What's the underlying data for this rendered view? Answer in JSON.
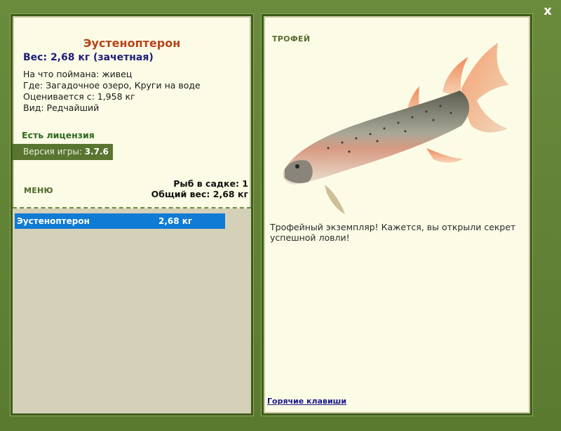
{
  "window": {
    "close_label": "x"
  },
  "fish": {
    "name": "Эустеноптерон",
    "weight": "Вес: 2,68 кг (зачетная)",
    "caught_on": "На что поймана: живец",
    "location": "Где: Загадочное озеро, Круги на воде",
    "value": "Оценивается с: 1,958 кг",
    "rarity": "Вид: Редчайший"
  },
  "license": "Есть лицензия",
  "version": {
    "label": "Версия игры:",
    "value": "3.7.6"
  },
  "menu_label": "МЕНЮ",
  "keepnet": {
    "count": "Рыб в садке: 1",
    "total": "Общий вес: 2,68 кг"
  },
  "catch_list": [
    {
      "name": "Эустеноптерон",
      "weight": "2,68 кг"
    }
  ],
  "trophy": {
    "title": "ТРОФЕЙ",
    "text": "Трофейный экземпляр! Кажется, вы открыли секрет успешной ловли!"
  },
  "hotkeys_label": "Горячие клавиши",
  "icons": {
    "close": "close-icon",
    "fish": "fish-image"
  },
  "colors": {
    "accent_frame": "#5e7f34",
    "selection": "#0f7bd4",
    "fish_name": "#b5451b"
  }
}
